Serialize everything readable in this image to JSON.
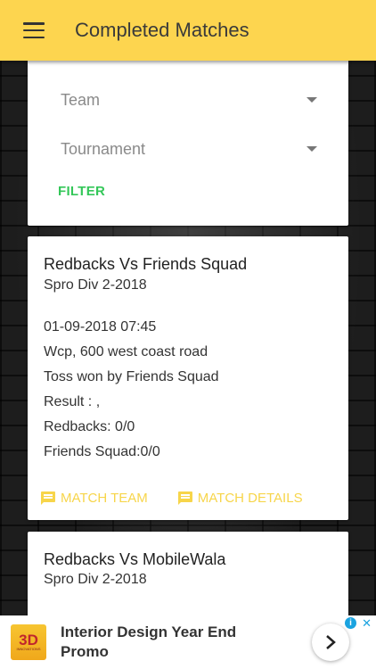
{
  "app_bar": {
    "title": "Completed Matches"
  },
  "filter": {
    "team_label": "Team",
    "tournament_label": "Tournament",
    "filter_button": "FILTER"
  },
  "matches": [
    {
      "title": "Redbacks Vs Friends Squad",
      "tournament": "Spro Div 2-2018",
      "datetime": "01-09-2018 07:45",
      "venue": "Wcp, 600 west coast road",
      "toss": "Toss won by Friends Squad",
      "result": "Result : ,",
      "score_a": "Redbacks: 0/0",
      "score_b": "Friends Squad:0/0",
      "action_team": "MATCH TEAM",
      "action_details": "MATCH DETAILS"
    },
    {
      "title": "Redbacks Vs MobileWala",
      "tournament": "Spro Div 2-2018"
    }
  ],
  "ad": {
    "logo_text": "3D",
    "logo_subtext": "INNOVATIONS",
    "text": "Interior Design Year End Promo",
    "info_icon": "info-icon",
    "close_icon": "close-icon"
  },
  "colors": {
    "accent": "#FDD54F",
    "filter_green": "#34c759",
    "action_yellow": "#F7D54A"
  }
}
